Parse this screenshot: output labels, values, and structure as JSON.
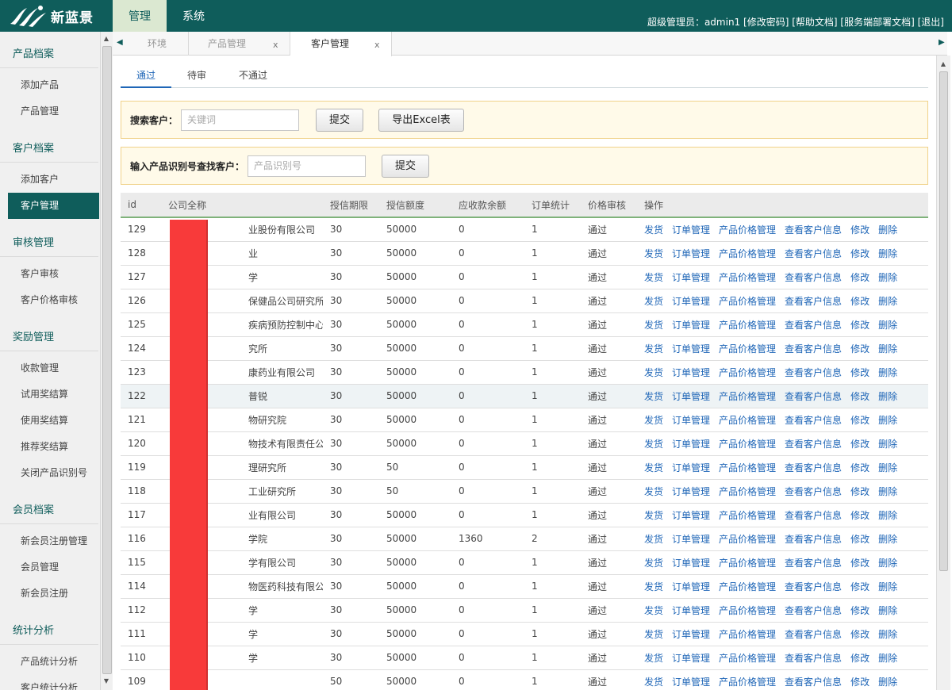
{
  "app": {
    "brand": "新蓝景",
    "nav_tabs": [
      "管理",
      "系统"
    ],
    "user_prefix": "超级管理员：",
    "username": "admin1",
    "user_links": [
      "[修改密码]",
      "[帮助文档]",
      "[服务端部署文档]",
      "[退出]"
    ]
  },
  "sidebar": {
    "groups": [
      {
        "title": "产品档案",
        "items": [
          "添加产品",
          "产品管理"
        ]
      },
      {
        "title": "客户档案",
        "items": [
          "添加客户",
          "客户管理"
        ]
      },
      {
        "title": "审核管理",
        "items": [
          "客户审核",
          "客户价格审核"
        ]
      },
      {
        "title": "奖励管理",
        "items": [
          "收款管理",
          "试用奖结算",
          "使用奖结算",
          "推荐奖结算",
          "关闭产品识别号"
        ]
      },
      {
        "title": "会员档案",
        "items": [
          "新会员注册管理",
          "会员管理",
          "新会员注册"
        ]
      },
      {
        "title": "统计分析",
        "items": [
          "产品统计分析",
          "客户统计分析"
        ]
      }
    ],
    "active_item": "客户管理"
  },
  "page_tabs": [
    {
      "label": "环境",
      "closable": false
    },
    {
      "label": "产品管理",
      "closable": true,
      "close": "x"
    },
    {
      "label": "客户管理",
      "closable": true,
      "close": "x",
      "active": true
    }
  ],
  "sub_tabs": {
    "items": [
      "通过",
      "待审",
      "不通过"
    ],
    "active": "通过"
  },
  "search1": {
    "label": "搜索客户：",
    "placeholder": "关键词",
    "submit": "提交",
    "export": "导出Excel表"
  },
  "search2": {
    "label": "输入产品识别号查找客户：",
    "placeholder": "产品识别号",
    "submit": "提交"
  },
  "table": {
    "columns": [
      "id",
      "公司全称",
      "授信期限",
      "授信额度",
      "应收款余额",
      "订单统计",
      "价格审核",
      "操作"
    ],
    "actions": [
      "发货",
      "订单管理",
      "产品价格管理",
      "查看客户信息",
      "修改",
      "删除"
    ],
    "rows": [
      {
        "id": "129",
        "name": "业股份有限公司",
        "term": "30",
        "limit": "50000",
        "balance": "0",
        "orders": "1",
        "audit": "通过"
      },
      {
        "id": "128",
        "name": "业",
        "term": "30",
        "limit": "50000",
        "balance": "0",
        "orders": "1",
        "audit": "通过"
      },
      {
        "id": "127",
        "name": "学",
        "term": "30",
        "limit": "50000",
        "balance": "0",
        "orders": "1",
        "audit": "通过"
      },
      {
        "id": "126",
        "name": "保健品公司研究所",
        "term": "30",
        "limit": "50000",
        "balance": "0",
        "orders": "1",
        "audit": "通过"
      },
      {
        "id": "125",
        "name": "疾病预防控制中心",
        "term": "30",
        "limit": "50000",
        "balance": "0",
        "orders": "1",
        "audit": "通过"
      },
      {
        "id": "124",
        "name": "究所",
        "term": "30",
        "limit": "50000",
        "balance": "0",
        "orders": "1",
        "audit": "通过"
      },
      {
        "id": "123",
        "name": "康药业有限公司",
        "term": "30",
        "limit": "50000",
        "balance": "0",
        "orders": "1",
        "audit": "通过"
      },
      {
        "id": "122",
        "name": "普锐",
        "term": "30",
        "limit": "50000",
        "balance": "0",
        "orders": "1",
        "audit": "通过",
        "highlight": true
      },
      {
        "id": "121",
        "name": "物研究院",
        "term": "30",
        "limit": "50000",
        "balance": "0",
        "orders": "1",
        "audit": "通过"
      },
      {
        "id": "120",
        "name": "物技术有限责任公司",
        "term": "30",
        "limit": "50000",
        "balance": "0",
        "orders": "1",
        "audit": "通过"
      },
      {
        "id": "119",
        "name": "理研究所",
        "term": "30",
        "limit": "50",
        "balance": "0",
        "orders": "1",
        "audit": "通过"
      },
      {
        "id": "118",
        "name": "工业研究所",
        "term": "30",
        "limit": "50",
        "balance": "0",
        "orders": "1",
        "audit": "通过"
      },
      {
        "id": "117",
        "name": "业有限公司",
        "term": "30",
        "limit": "50000",
        "balance": "0",
        "orders": "1",
        "audit": "通过"
      },
      {
        "id": "116",
        "name": "学院",
        "term": "30",
        "limit": "50000",
        "balance": "1360",
        "orders": "2",
        "audit": "通过"
      },
      {
        "id": "115",
        "name": "学有限公司",
        "term": "30",
        "limit": "50000",
        "balance": "0",
        "orders": "1",
        "audit": "通过"
      },
      {
        "id": "114",
        "name": "物医药科技有限公司",
        "term": "30",
        "limit": "50000",
        "balance": "0",
        "orders": "1",
        "audit": "通过"
      },
      {
        "id": "112",
        "name": "学",
        "term": "30",
        "limit": "50000",
        "balance": "0",
        "orders": "1",
        "audit": "通过"
      },
      {
        "id": "111",
        "name": "学",
        "term": "30",
        "limit": "50000",
        "balance": "0",
        "orders": "1",
        "audit": "通过"
      },
      {
        "id": "110",
        "name": "学",
        "term": "30",
        "limit": "50000",
        "balance": "0",
        "orders": "1",
        "audit": "通过"
      },
      {
        "id": "109",
        "name": "",
        "term": "50",
        "limit": "50000",
        "balance": "0",
        "orders": "1",
        "audit": "通过"
      }
    ]
  },
  "colors": {
    "theme": "#0f5d5b",
    "link": "#1f66b7",
    "redaction": "#f83a3a",
    "search_bg": "#fffae9"
  }
}
